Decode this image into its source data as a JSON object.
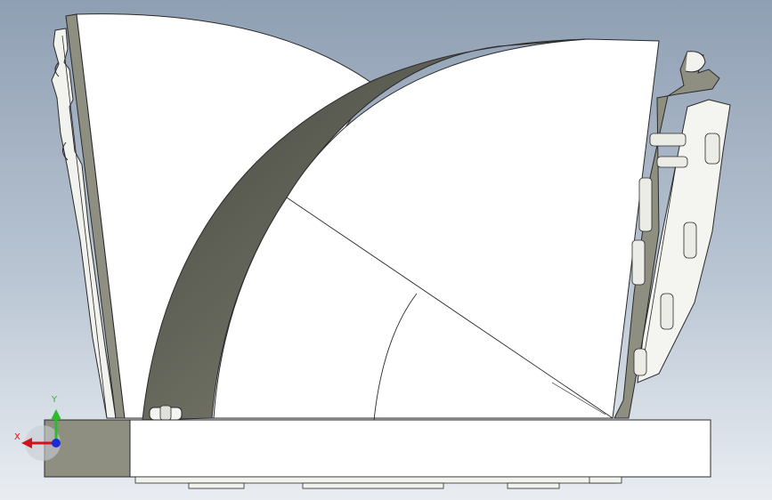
{
  "viewport": {
    "background_top": "#8f9fb3",
    "background_bottom": "#e9edf2"
  },
  "triad": {
    "x_label": "X",
    "y_label": "Y",
    "x_color": "#d0141e",
    "y_color": "#2dbb2d",
    "z_color": "#1b2bd8"
  },
  "model": {
    "face_color": "#ffffff",
    "edge_color": "#2a2a2a",
    "shade_color": "#8e8f80",
    "dark_shade_color": "#4a4b42"
  }
}
